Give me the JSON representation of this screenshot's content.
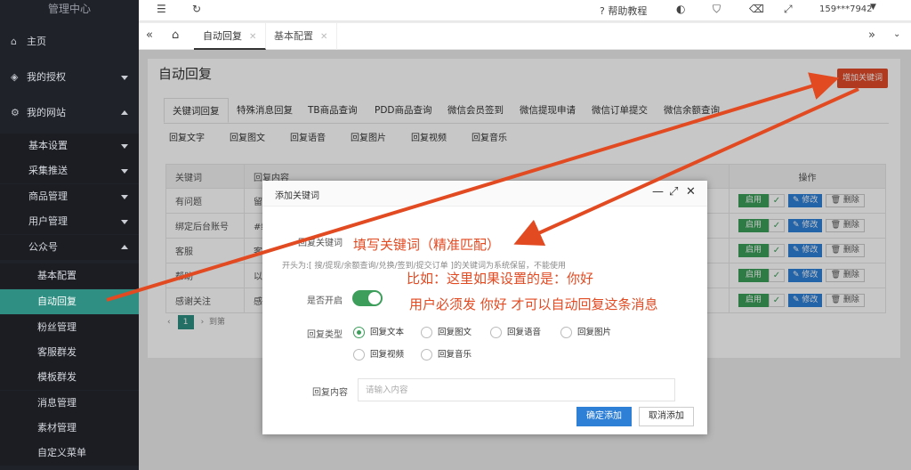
{
  "sidebar": {
    "header": "管理中心",
    "items": [
      {
        "label": "主页",
        "icon": "home-icon"
      },
      {
        "label": "我的授权",
        "icon": "shield-icon"
      },
      {
        "label": "我的网站",
        "icon": "gear-icon"
      },
      {
        "label": "基本设置"
      },
      {
        "label": "采集推送"
      },
      {
        "label": "商品管理"
      },
      {
        "label": "用户管理"
      },
      {
        "label": "公众号"
      },
      {
        "label": "基本配置"
      },
      {
        "label": "自动回复"
      },
      {
        "label": "粉丝管理"
      },
      {
        "label": "客服群发"
      },
      {
        "label": "模板群发"
      },
      {
        "label": "消息管理"
      },
      {
        "label": "素材管理"
      },
      {
        "label": "自定义菜单"
      }
    ]
  },
  "topbar": {
    "help": "? 帮助教程",
    "user": "159***7942"
  },
  "tabs": [
    {
      "label": "自动回复"
    },
    {
      "label": "基本配置"
    }
  ],
  "page": {
    "title": "自动回复",
    "add_button": "增加关键词",
    "keyword_tabs": [
      "关键词回复",
      "特殊消息回复",
      "TB商品查询",
      "PDD商品查询",
      "微信会员签到",
      "微信提现申请",
      "微信订单提交",
      "微信余额查询"
    ],
    "sub_tabs": [
      "回复文字",
      "回复图文",
      "回复语音",
      "回复图片",
      "回复视频",
      "回复音乐"
    ]
  },
  "table": {
    "headers": [
      "关键词",
      "回复内容",
      "操作"
    ],
    "rows": [
      {
        "keyword": "有问题",
        "content": "留"
      },
      {
        "keyword": "绑定后台账号",
        "content": "#绑"
      },
      {
        "keyword": "客服",
        "content": "客"
      },
      {
        "keyword": "帮助",
        "content": "以"
      },
      {
        "keyword": "感谢关注",
        "content": "感"
      }
    ],
    "enable_label": "启用",
    "edit_label": "✎ 修改",
    "delete_label": "🗑 删除",
    "pager_page": "1",
    "pager_goto": "到第"
  },
  "dialog": {
    "title": "添加关键词",
    "keyword_label": "回复关键词",
    "hint": "开头为:[ 搜/提现/余额查询/兑换/签到/提交订单 ]的关键词为系统保留，不能使用",
    "enable_label": "是否开启",
    "type_label": "回复类型",
    "types": [
      "回复文本",
      "回复图文",
      "回复语音",
      "回复图片",
      "回复视频",
      "回复音乐"
    ],
    "content_label": "回复内容",
    "content_placeholder": "请输入内容",
    "ok": "确定添加",
    "cancel": "取消添加"
  },
  "annotations": {
    "line1": "填写关键词（精准匹配）",
    "line2": "比如：这里如果设置的是：你好",
    "line3": "用户必须发 你好 才可以自动回复这条消息"
  },
  "colors": {
    "accent": "#2f8f82",
    "annotation": "#e24a22",
    "primary": "#2e7fd6"
  }
}
